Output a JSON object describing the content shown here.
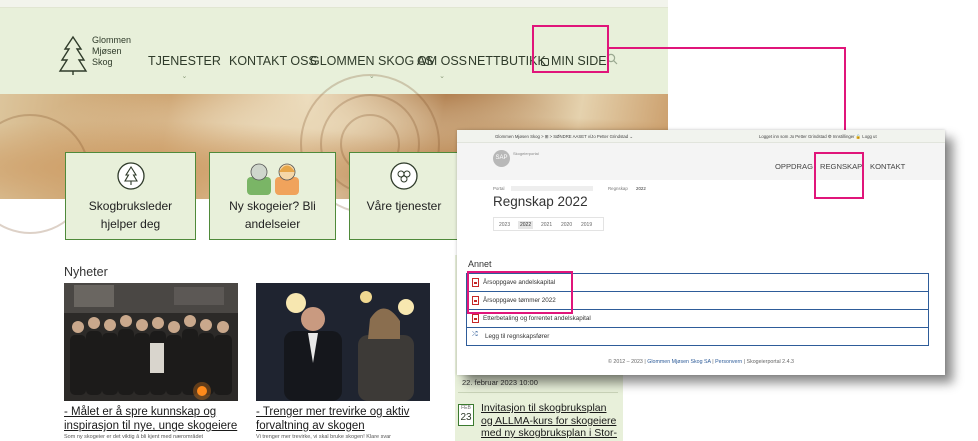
{
  "site": {
    "logo": {
      "line1": "Glommen",
      "line2": "Mjøsen",
      "line3": "Skog"
    },
    "nav": [
      "TJENESTER",
      "KONTAKT OSS",
      "GLOMMEN SKOG AS",
      "OM OSS",
      "NETTBUTIKK",
      "MIN SIDE"
    ],
    "cards": [
      {
        "line1": "Skogbruksleder",
        "line2": "hjelper deg",
        "icon": "tree-icon"
      },
      {
        "line1": "Ny skogeier? Bli",
        "line2": "andelseier",
        "icon": "people-icon"
      },
      {
        "line1": "Våre tjenester",
        "line2": "",
        "icon": "log-icon"
      }
    ],
    "news_heading": "Nyheter",
    "news": [
      {
        "title": "- Målet er å spre kunnskap og inspirasjon til nye, unge skogeiere",
        "snippet": "Som ny skogeier er det viktig å bli kjent med nærområdet"
      },
      {
        "title": "- Trenger mer trevirke og aktiv forvaltning av skogen",
        "snippet": "Vi trenger mer trevirke, vi skal bruke skogen! Klare svar"
      }
    ],
    "event_date": "22. februar 2023 10:00",
    "event": {
      "month": "FEB",
      "day": "23",
      "title": "Invitasjon til skogbruksplan og ALLMA-kurs for skogeiere med ny skogbruksplan i Stor-Elvdal/S..."
    },
    "accent_color": "#e0157a",
    "brand_green": "#4f8a3a"
  },
  "portal": {
    "topbar_left": "Glommen Mjøsen Skog > ⊞ > SØNDRE AASET v/Jo Petter Grindstad ⌄",
    "topbar_right": "Logget inn som Jo Petter Grindstad   ⚙ Innstillinger   🔒 Logg ut",
    "logo_text": "SAP",
    "logo_caption": "Skogeierportal",
    "nav": [
      "OPPDRAG",
      "REGNSKAP",
      "KONTAKT"
    ],
    "breadcrumb_portal": "Portal",
    "breadcrumb_regnskap": "Regnskap",
    "breadcrumb_year": "2022",
    "title": "Regnskap 2022",
    "years": [
      "2023",
      "2022",
      "2021",
      "2020",
      "2019"
    ],
    "selected_year": "2022",
    "section": "Annet",
    "rows": [
      "Årsoppgave andelskapital",
      "Årsoppgave tømmer 2022",
      "Etterbetaling og forrentet andelskapital",
      "Legg til regnskapsfører"
    ],
    "footer_text": "© 2012 – 2023 | ",
    "footer_link1": "Glommen Mjøsen Skog SA",
    "footer_sep": " | ",
    "footer_link2": "Personvern",
    "footer_tail": " | Skogeierportal 2.4.3"
  }
}
